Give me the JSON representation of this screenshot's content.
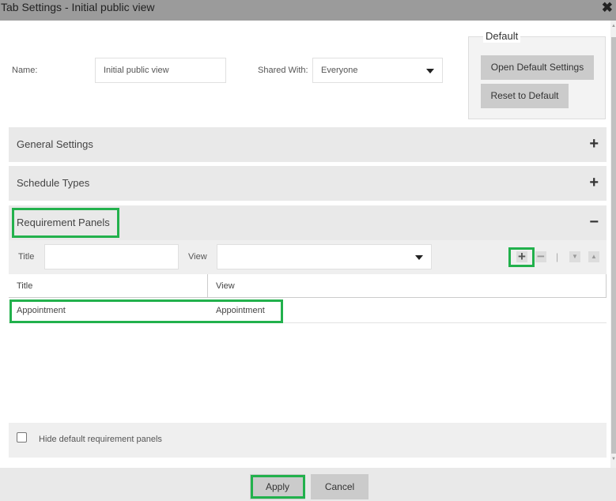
{
  "window": {
    "title": "Tab Settings - Initial public view",
    "close_icon": "✖"
  },
  "form": {
    "name_label": "Name:",
    "name_value": "Initial public view",
    "shared_label": "Shared With:",
    "shared_value": "Everyone"
  },
  "default_group": {
    "legend": "Default",
    "open_label": "Open Default Settings",
    "reset_label": "Reset to Default"
  },
  "sections": [
    {
      "label": "General Settings",
      "icon": "+",
      "state": "collapsed"
    },
    {
      "label": "Schedule Types",
      "icon": "+",
      "state": "collapsed"
    },
    {
      "label": "Requirement Panels",
      "icon": "−",
      "state": "expanded"
    }
  ],
  "requirement_panels": {
    "title_label": "Title",
    "title_value": "",
    "view_label": "View",
    "view_value": "",
    "toolbar": {
      "add_icon": "+",
      "remove_icon": "−",
      "separator": "|",
      "move_down_icon": "▼",
      "move_up_icon": "▲"
    },
    "columns": [
      "Title",
      "View"
    ],
    "rows": [
      {
        "title": "Appointment",
        "view": "Appointment"
      }
    ],
    "hide_default_label": "Hide default requirement panels",
    "hide_default_checked": false
  },
  "footer": {
    "apply_label": "Apply",
    "cancel_label": "Cancel"
  },
  "colors": {
    "highlight": "#22b14c",
    "titlebar": "#9b9b9b",
    "button": "#cbcbcb"
  }
}
